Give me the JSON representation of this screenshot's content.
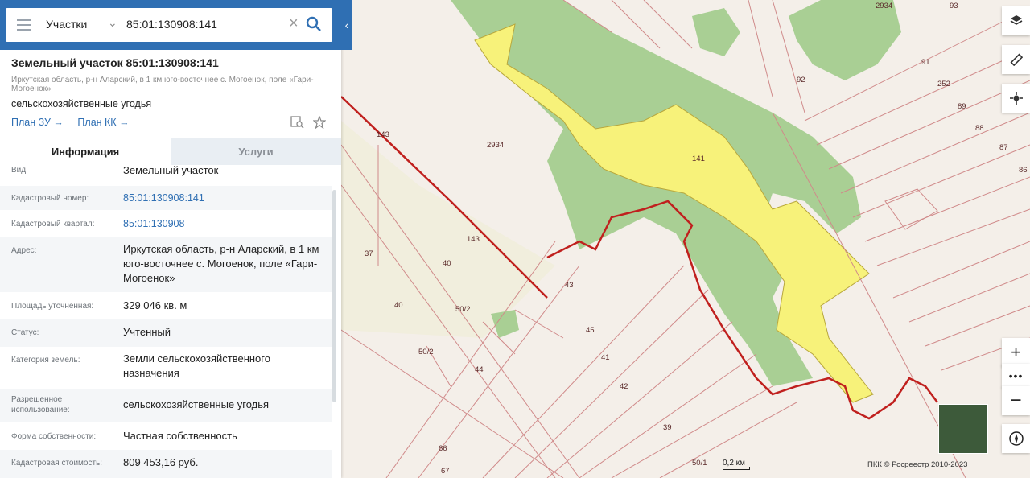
{
  "search": {
    "type_label": "Участки",
    "query": "85:01:130908:141"
  },
  "card": {
    "title": "Земельный участок 85:01:130908:141",
    "address_gray": "Иркутская область, р-н Аларский, в 1 км юго-восточнее с. Могоенок, поле «Гари-Могоенок»",
    "category": "сельскохозяйственные угодья",
    "links": [
      "План ЗУ →",
      "План КК →"
    ]
  },
  "tabs": [
    "Информация",
    "Услуги"
  ],
  "rows": [
    {
      "label": "Вид:",
      "value": "Земельный участок"
    },
    {
      "label": "Кадастровый номер:",
      "value": "85:01:130908:141"
    },
    {
      "label": "Кадастровый квартал:",
      "value": "85:01:130908"
    },
    {
      "label": "Адрес:",
      "value": "Иркутская область, р-н Аларский, в 1 км юго-восточнее с. Могоенок, поле «Гари-Могоенок»"
    },
    {
      "label": "Площадь уточненная:",
      "value": "329 046 кв. м"
    },
    {
      "label": "Статус:",
      "value": "Учтенный"
    },
    {
      "label": "Категория земель:",
      "value": "Земли сельскохозяйственного назначения"
    },
    {
      "label": "Разрешенное использование:",
      "value": "сельскохозяйственные угодья"
    },
    {
      "label": "Форма собственности:",
      "value": "Частная собственность"
    },
    {
      "label": "Кадастровая стоимость:",
      "value": "809 453,16 руб."
    }
  ],
  "map": {
    "parcel_labels": [
      "2934",
      "141",
      "143",
      "143",
      "37",
      "40",
      "40",
      "50/2",
      "50/2",
      "43",
      "45",
      "41",
      "42",
      "44",
      "39",
      "66",
      "67",
      "50/1",
      "2934",
      "93",
      "91",
      "92",
      "252",
      "89",
      "88",
      "87",
      "86"
    ],
    "scale": "0,2 км",
    "copyright": "ПКК © Росреестр 2010-2023"
  },
  "colors": {
    "header": "#2f6fb3",
    "selected_parcel": "#f7f27a",
    "forest": "#a9cf94",
    "boundary": "#c0201e"
  }
}
